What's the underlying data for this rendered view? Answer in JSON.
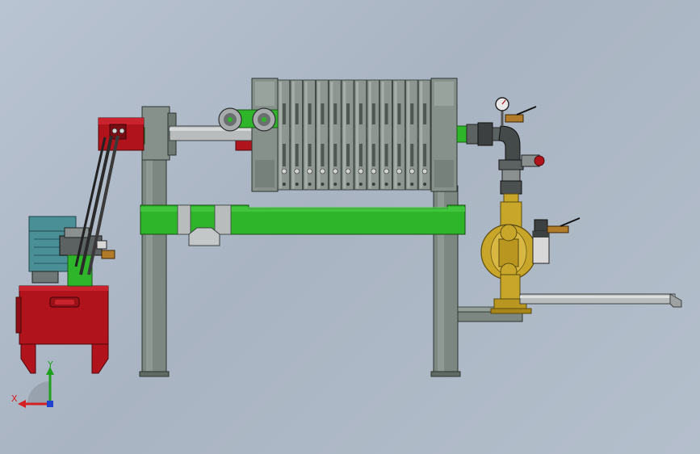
{
  "colors": {
    "background": "#aeb9c7",
    "frame": "#7b8780",
    "plates": "#8d9690",
    "green": "#2fb52a",
    "red": "#b1131c",
    "motor": "#4b8f96",
    "pump": "#c8a62a",
    "pipe": "#b9bcbc"
  },
  "plate_count": 12,
  "axis_triad": {
    "x_label": "X",
    "y_label": "Y",
    "x_color": "#d42020",
    "y_color": "#1ea01e",
    "z_color": "#2040d0"
  }
}
